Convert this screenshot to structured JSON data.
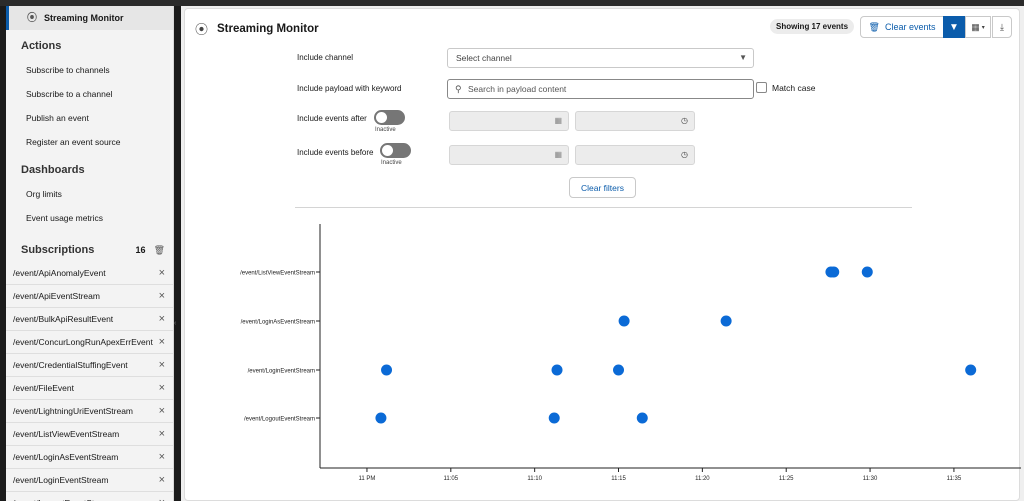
{
  "sidebar": {
    "top_item": "Streaming Monitor",
    "sections": [
      {
        "heading": "Actions",
        "items": [
          "Subscribe to channels",
          "Subscribe to a channel",
          "Publish an event",
          "Register an event source"
        ]
      },
      {
        "heading": "Dashboards",
        "items": [
          "Org limits",
          "Event usage metrics"
        ]
      }
    ],
    "subscriptions_heading": "Subscriptions",
    "subscriptions_count": "16",
    "subscriptions": [
      "/event/ApiAnomalyEvent",
      "/event/ApiEventStream",
      "/event/BulkApiResultEvent",
      "/event/ConcurLongRunApexErrEvent",
      "/event/CredentialStuffingEvent",
      "/event/FileEvent",
      "/event/LightningUriEventStream",
      "/event/ListViewEventStream",
      "/event/LoginAsEventStream",
      "/event/LoginEventStream",
      "/event/LogoutEventStream"
    ]
  },
  "header": {
    "title": "Streaming Monitor",
    "event_count": "Showing 17 events",
    "clear_events": "Clear events"
  },
  "filters": {
    "channel_label": "Include channel",
    "channel_placeholder": "Select channel",
    "keyword_label": "Include payload with keyword",
    "keyword_placeholder": "Search in payload content",
    "match_case": "Match case",
    "after_label": "Include events after",
    "before_label": "Include events before",
    "toggle_state": "Inactive",
    "clear_filters": "Clear filters"
  },
  "chart_data": {
    "type": "scatter",
    "title": "",
    "xlabel": "",
    "ylabel": "",
    "categories": [
      "/event/ListViewEventStream",
      "/event/LoginAsEventStream",
      "/event/LoginEventStream",
      "/event/LogoutEventStream"
    ],
    "x_ticks": [
      "11 PM",
      "11:05",
      "11:10",
      "11:15",
      "11:20",
      "11:25",
      "11:30",
      "11:35"
    ],
    "x_range_minutes": [
      -2.8,
      39
    ],
    "point_color": "#0b6ad6",
    "points": [
      {
        "channel": "/event/ListViewEventStream",
        "time": "11:27:40"
      },
      {
        "channel": "/event/ListViewEventStream",
        "time": "11:27:50"
      },
      {
        "channel": "/event/ListViewEventStream",
        "time": "11:29:50"
      },
      {
        "channel": "/event/LoginAsEventStream",
        "time": "11:15:20"
      },
      {
        "channel": "/event/LoginAsEventStream",
        "time": "11:21:25"
      },
      {
        "channel": "/event/LoginEventStream",
        "time": "11:01:10"
      },
      {
        "channel": "/event/LoginEventStream",
        "time": "11:11:20"
      },
      {
        "channel": "/event/LoginEventStream",
        "time": "11:15:00"
      },
      {
        "channel": "/event/LoginEventStream",
        "time": "11:36:00"
      },
      {
        "channel": "/event/LogoutEventStream",
        "time": "11:00:50"
      },
      {
        "channel": "/event/LogoutEventStream",
        "time": "11:11:10"
      },
      {
        "channel": "/event/LogoutEventStream",
        "time": "11:16:25"
      }
    ]
  }
}
